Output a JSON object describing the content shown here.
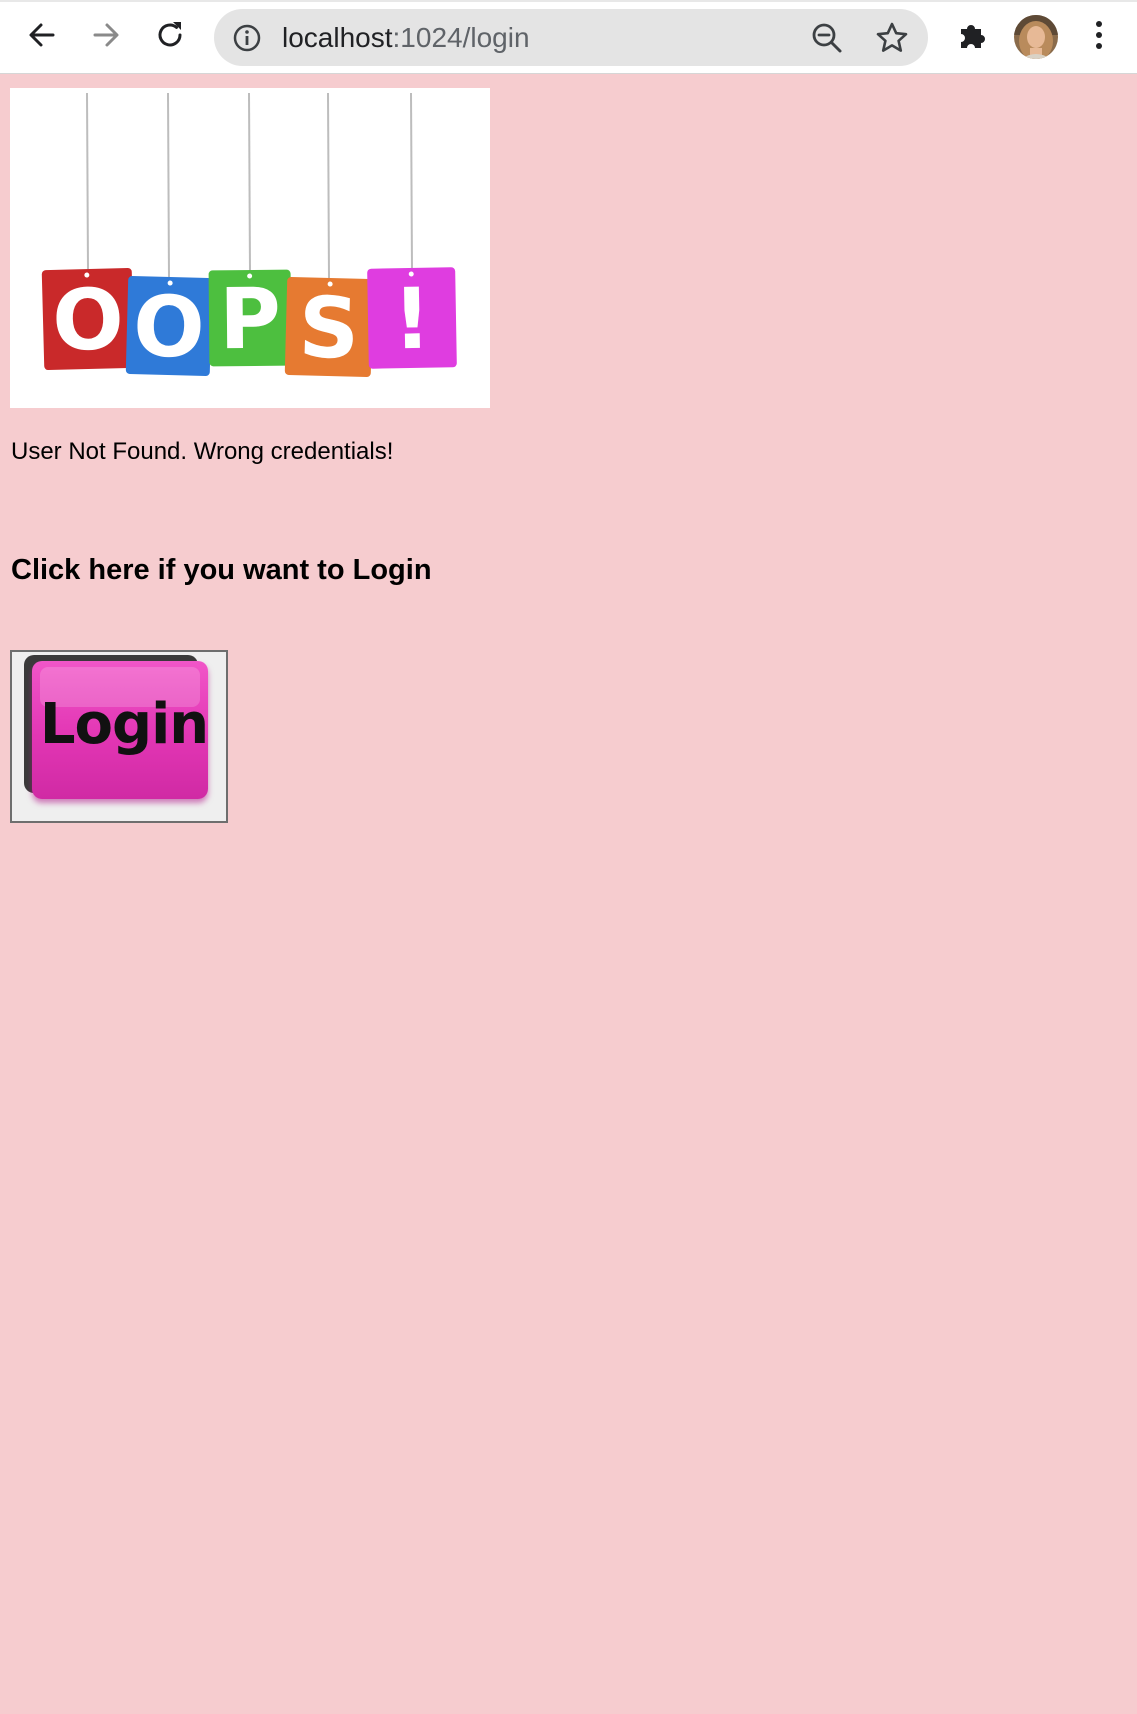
{
  "browser": {
    "url_host": "localhost",
    "url_path": ":1024/login"
  },
  "page": {
    "background_color": "#f6cccf",
    "banner": {
      "tags": [
        {
          "letter": "O",
          "color": "#c9292a"
        },
        {
          "letter": "O",
          "color": "#2f7ad8"
        },
        {
          "letter": "P",
          "color": "#4dbf3f"
        },
        {
          "letter": "S",
          "color": "#e67a31"
        },
        {
          "letter": "!",
          "color": "#df3de0"
        }
      ]
    },
    "error_message": "User Not Found. Wrong credentials!",
    "login_prompt": "Click here if you want to Login",
    "login_button_label": "Login",
    "login_button_color": "#e63cb8"
  },
  "icons": {
    "back": "arrow-left-icon",
    "forward": "arrow-right-icon",
    "reload": "reload-icon",
    "info": "info-icon",
    "zoom": "zoom-out-icon",
    "bookmark": "star-icon",
    "extensions": "puzzle-icon",
    "menu": "kebab-menu-icon"
  }
}
